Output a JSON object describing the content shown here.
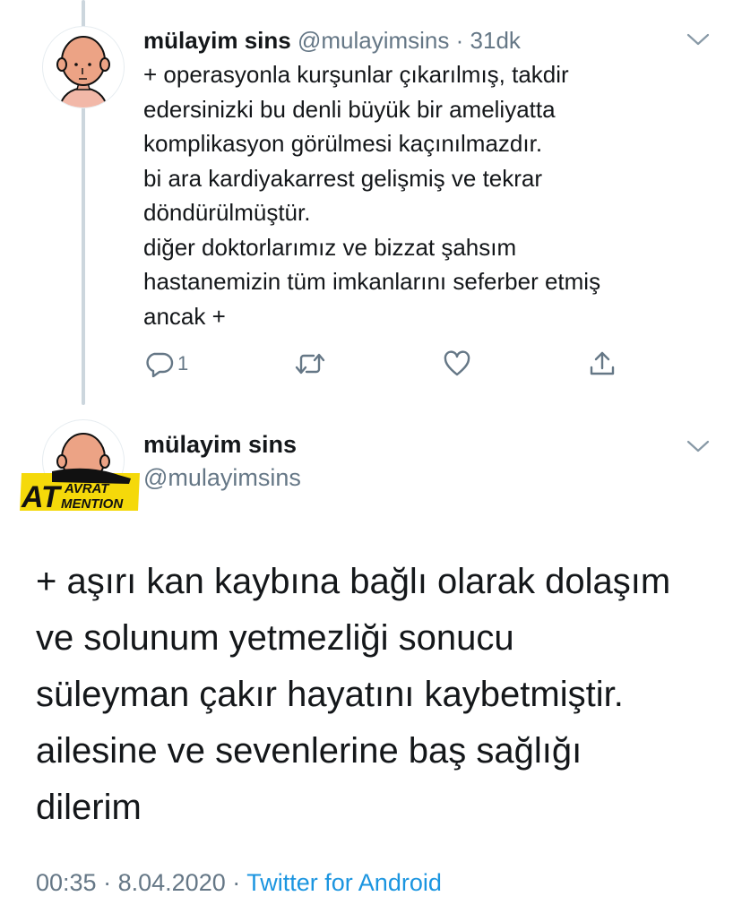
{
  "reply_tweet": {
    "display_name": "mülayim sins",
    "handle": "@mulayimsins",
    "separator": "·",
    "time": "31dk",
    "text": "+ operasyonla kurşunlar çıkarılmış, takdir\nedersinizki bu denli büyük bir ameliyatta\nkomplikasyon görülmesi kaçınılmazdır.\nbi ara kardiyakarrest gelişmiş ve tekrar\ndöndürülmüştür.\ndiğer doktorlarımız ve bizzat şahsım\nhastanemizin tüm imkanlarını seferber etmiş\nancak +",
    "reply_count": "1",
    "icons": [
      "reply-icon",
      "retweet-icon",
      "like-icon",
      "share-icon"
    ]
  },
  "main_tweet": {
    "display_name": "mülayim sins",
    "handle": "@mulayimsins",
    "text": "+ aşırı kan kaybına bağlı olarak dolaşım\nve solunum yetmezliği sonucu\nsüleyman çakır hayatını kaybetmiştir.\nailesine ve sevenlerine baş sağlığı\ndilerim",
    "time": "00:35",
    "separator": "·",
    "date": "8.04.2020",
    "source": "Twitter for Android"
  },
  "watermark": {
    "big": "AT",
    "top": "AVRAT",
    "bottom": "MENTION"
  },
  "colors": {
    "text": "#14171a",
    "muted": "#657786",
    "link": "#1b95e0",
    "thread_line": "#ccd6dd",
    "badge_yellow": "#f5d90a"
  }
}
